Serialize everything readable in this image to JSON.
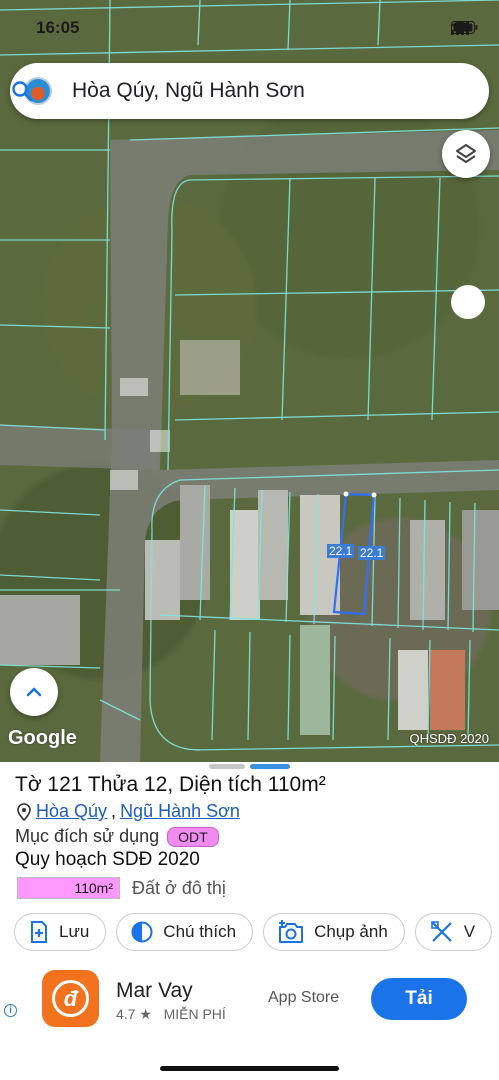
{
  "status_bar": {
    "time": "16:05"
  },
  "search": {
    "query": "Hòa Qúy, Ngũ Hành Sơn"
  },
  "map": {
    "attribution": "Google",
    "layer_label": "QHSDĐ 2020",
    "plot_edge_left": "22.1",
    "plot_edge_right": "22.1"
  },
  "parcel": {
    "title": "Tờ 121 Thửa 12, Diện tích 110m²",
    "ward": "Hòa Qúy",
    "separator": ",",
    "district": "Ngũ Hành Sơn",
    "purpose_label": "Mục đích sử dụng",
    "purpose_code": "ODT",
    "plan_label": "Quy hoạch SDĐ 2020",
    "area_value": "110m²",
    "area_desc": "Đất ở đô thị",
    "zone_color": "#ff99ff"
  },
  "actions": [
    {
      "label": "Lưu",
      "icon": "add-bookmark-icon"
    },
    {
      "label": "Chú thích",
      "icon": "contrast-icon"
    },
    {
      "label": "Chụp ảnh",
      "icon": "add-photo-icon"
    },
    {
      "label": "V",
      "icon": "ruler-icon"
    }
  ],
  "ad": {
    "app_name": "Mar Vay",
    "rating": "4.7 ★",
    "price": "MIỄN PHÍ",
    "store": "App Store",
    "install_label": "Tải",
    "logo_letter": "đ",
    "info_glyph": "i"
  }
}
